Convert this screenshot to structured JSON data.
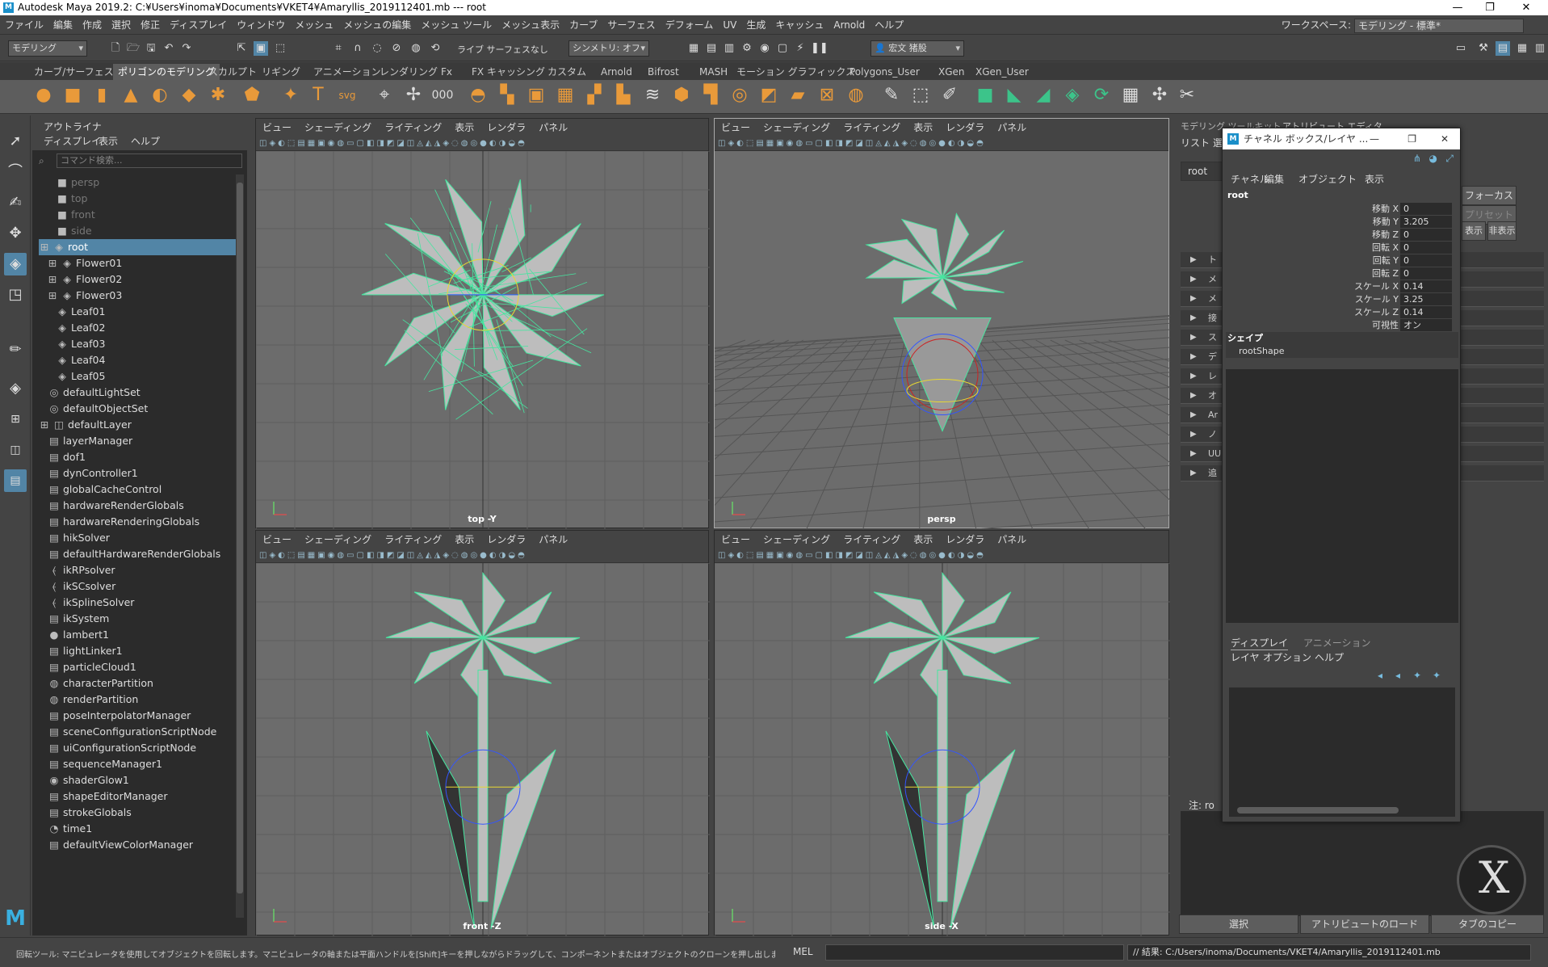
{
  "window": {
    "title": "Autodesk Maya 2019.2: C:¥Users¥inoma¥Documents¥VKET4¥Amaryllis_2019112401.mb  ---  root",
    "logo": "M",
    "min": "—",
    "max": "❐",
    "close": "✕"
  },
  "menus": [
    "ファイル",
    "編集",
    "作成",
    "選択",
    "修正",
    "ディスプレイ",
    "ウィンドウ",
    "メッシュ",
    "メッシュの編集",
    "メッシュ ツール",
    "メッシュ表示",
    "カーブ",
    "サーフェス",
    "デフォーム",
    "UV",
    "生成",
    "キャッシュ",
    "Arnold",
    "ヘルプ"
  ],
  "workspace": {
    "label": "ワークスペース:",
    "value": "モデリング - 標準*"
  },
  "statusline": {
    "mode": "モデリング",
    "live": "ライブ サーフェスなし",
    "symmetry": "シンメトリ: オフ",
    "user": "宏文 猪股"
  },
  "shelf_tabs": [
    "カーブ/サーフェス",
    "ポリゴンのモデリング",
    "スカルプト",
    "リギング",
    "アニメーション",
    "レンダリング",
    "Fx",
    "FX キャッシング",
    "カスタム",
    "Arnold",
    "Bifrost",
    "MASH",
    "モーション グラフィックス",
    "Polygons_User",
    "XGen",
    "XGen_User"
  ],
  "shelf_active": "ポリゴンのモデリング",
  "outliner": {
    "tab": "アウトライナ",
    "menu": [
      "ディスプレイ",
      "表示",
      "ヘルプ"
    ],
    "search_placeholder": "コマンド検索...",
    "items": [
      {
        "label": "persp",
        "icon": "camera",
        "dim": true
      },
      {
        "label": "top",
        "icon": "camera",
        "dim": true
      },
      {
        "label": "front",
        "icon": "camera",
        "dim": true
      },
      {
        "label": "side",
        "icon": "camera",
        "dim": true
      },
      {
        "label": "root",
        "icon": "transform",
        "selected": true
      },
      {
        "label": "Flower01",
        "icon": "transform"
      },
      {
        "label": "Flower02",
        "icon": "transform"
      },
      {
        "label": "Flower03",
        "icon": "transform"
      },
      {
        "label": "Leaf01",
        "icon": "transform"
      },
      {
        "label": "Leaf02",
        "icon": "transform"
      },
      {
        "label": "Leaf03",
        "icon": "transform"
      },
      {
        "label": "Leaf04",
        "icon": "transform"
      },
      {
        "label": "Leaf05",
        "icon": "transform"
      },
      {
        "label": "defaultLightSet",
        "icon": "set"
      },
      {
        "label": "defaultObjectSet",
        "icon": "set"
      },
      {
        "label": "defaultLayer",
        "icon": "layer"
      },
      {
        "label": "layerManager",
        "icon": "node"
      },
      {
        "label": "dof1",
        "icon": "node"
      },
      {
        "label": "dynController1",
        "icon": "node"
      },
      {
        "label": "globalCacheControl",
        "icon": "node"
      },
      {
        "label": "hardwareRenderGlobals",
        "icon": "node"
      },
      {
        "label": "hardwareRenderingGlobals",
        "icon": "node"
      },
      {
        "label": "hikSolver",
        "icon": "node"
      },
      {
        "label": "defaultHardwareRenderGlobals",
        "icon": "node"
      },
      {
        "label": "ikRPsolver",
        "icon": "ik"
      },
      {
        "label": "ikSCsolver",
        "icon": "ik"
      },
      {
        "label": "ikSplineSolver",
        "icon": "ik"
      },
      {
        "label": "ikSystem",
        "icon": "node"
      },
      {
        "label": "lambert1",
        "icon": "shader"
      },
      {
        "label": "lightLinker1",
        "icon": "node"
      },
      {
        "label": "particleCloud1",
        "icon": "node"
      },
      {
        "label": "characterPartition",
        "icon": "partition"
      },
      {
        "label": "renderPartition",
        "icon": "partition"
      },
      {
        "label": "poseInterpolatorManager",
        "icon": "node"
      },
      {
        "label": "sceneConfigurationScriptNode",
        "icon": "node"
      },
      {
        "label": "uiConfigurationScriptNode",
        "icon": "node"
      },
      {
        "label": "sequenceManager1",
        "icon": "node"
      },
      {
        "label": "shaderGlow1",
        "icon": "glow"
      },
      {
        "label": "shapeEditorManager",
        "icon": "node"
      },
      {
        "label": "strokeGlobals",
        "icon": "node"
      },
      {
        "label": "time1",
        "icon": "clock"
      },
      {
        "label": "defaultViewColorManager",
        "icon": "node"
      }
    ]
  },
  "viewport_menu": [
    "ビュー",
    "シェーディング",
    "ライティング",
    "表示",
    "レンダラ",
    "パネル"
  ],
  "viewports": [
    {
      "name": "top",
      "label": "top -Y"
    },
    {
      "name": "persp",
      "label": "persp"
    },
    {
      "name": "front",
      "label": "front -Z"
    },
    {
      "name": "side",
      "label": "side -X"
    }
  ],
  "attribute_editor": {
    "tabs": [
      "モデリング ツールキット",
      "アトリビュート エディタ"
    ],
    "menu": [
      "リスト",
      "選択"
    ],
    "node_field": "root",
    "focus": "フォーカス",
    "preset": "プリセット",
    "show": "表示",
    "hide": "非表示",
    "section_initials": [
      "ト",
      "メ",
      "メ",
      "接",
      "ス",
      "デ",
      "レ",
      "オ",
      "Ar",
      "ノ",
      "UU",
      "追"
    ],
    "note": "注: ro",
    "buttons": [
      "選択",
      "アトリビュートのロード",
      "タブのコピー"
    ]
  },
  "channel_box": {
    "title": "チャネル ボックス/レイヤ ...",
    "logo": "M",
    "menu": [
      "チャネル",
      "編集",
      "オブジェクト",
      "表示"
    ],
    "node": "root",
    "attrs": [
      {
        "label": "移動 X",
        "value": "0"
      },
      {
        "label": "移動 Y",
        "value": "3.205"
      },
      {
        "label": "移動 Z",
        "value": "0"
      },
      {
        "label": "回転 X",
        "value": "0"
      },
      {
        "label": "回転 Y",
        "value": "0"
      },
      {
        "label": "回転 Z",
        "value": "0"
      },
      {
        "label": "スケール X",
        "value": "0.14"
      },
      {
        "label": "スケール Y",
        "value": "3.25"
      },
      {
        "label": "スケール Z",
        "value": "0.14"
      },
      {
        "label": "可視性",
        "value": "オン"
      }
    ],
    "shape_header": "シェイプ",
    "shape": "rootShape",
    "layer_tabs": [
      "ディスプレイ",
      "アニメーション"
    ],
    "layer_menu": [
      "レイヤ",
      "オプション",
      "ヘルプ"
    ]
  },
  "cmdline": {
    "help": "回転ツール: マニピュレータを使用してオブジェクトを回転します。マニピュレータの軸または平面ハンドルを[Shift]キーを押しながらドラッグして、コンポーネントまたはオブジェクトのクローンを押し出します。[Ctrl]+[Shift]+左",
    "lang": "MEL",
    "result": "// 結果: C:/Users/inoma/Documents/VKET4/Amaryllis_2019112401.mb"
  },
  "colors": {
    "wire": "#46e6a0",
    "select": "#5285a6",
    "panel": "#444444",
    "viewport": "#6c6c6c"
  }
}
